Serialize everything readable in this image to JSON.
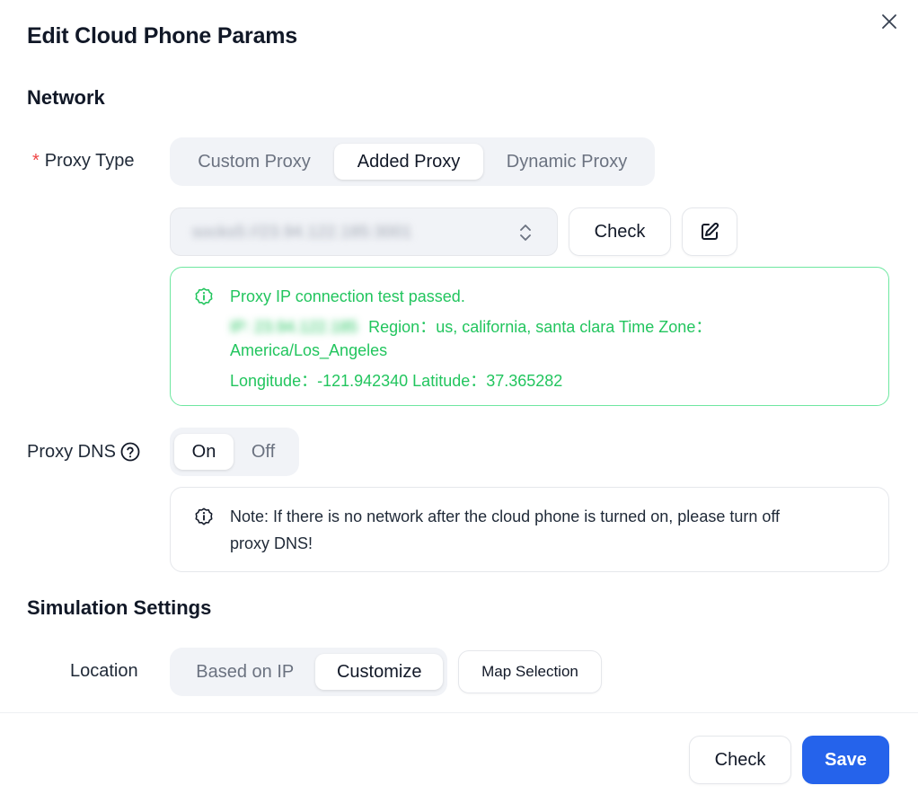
{
  "dialog": {
    "title": "Edit Cloud Phone Params"
  },
  "network": {
    "section_title": "Network",
    "proxy_type": {
      "required_mark": "*",
      "label": "Proxy Type",
      "options": [
        "Custom Proxy",
        "Added Proxy",
        "Dynamic Proxy"
      ],
      "selected": "Added Proxy"
    },
    "proxy_select": {
      "value": "socks5://23.94.122.185:3001"
    },
    "check_label": "Check",
    "test_result": {
      "line1": "Proxy IP connection test passed.",
      "ip_prefix": "IP:",
      "ip_value": "23.94.122.185",
      "region": "Region：us, california, santa clara  Time Zone：",
      "timezone": "America/Los_Angeles",
      "coords": "Longitude：-121.942340  Latitude：37.365282"
    },
    "proxy_dns": {
      "label": "Proxy DNS",
      "options": [
        "On",
        "Off"
      ],
      "selected": "On",
      "note_line1": "Note: If there is no network after the cloud phone is turned on, please turn off",
      "note_line2": "proxy DNS!"
    }
  },
  "simulation": {
    "section_title": "Simulation Settings",
    "location": {
      "label": "Location",
      "options": [
        "Based on IP",
        "Customize"
      ],
      "selected": "Customize",
      "map_button": "Map Selection"
    }
  },
  "footer": {
    "check_label": "Check",
    "save_label": "Save"
  },
  "colors": {
    "primary": "#2563eb",
    "success": "#22c55e",
    "required": "#ef4444"
  }
}
